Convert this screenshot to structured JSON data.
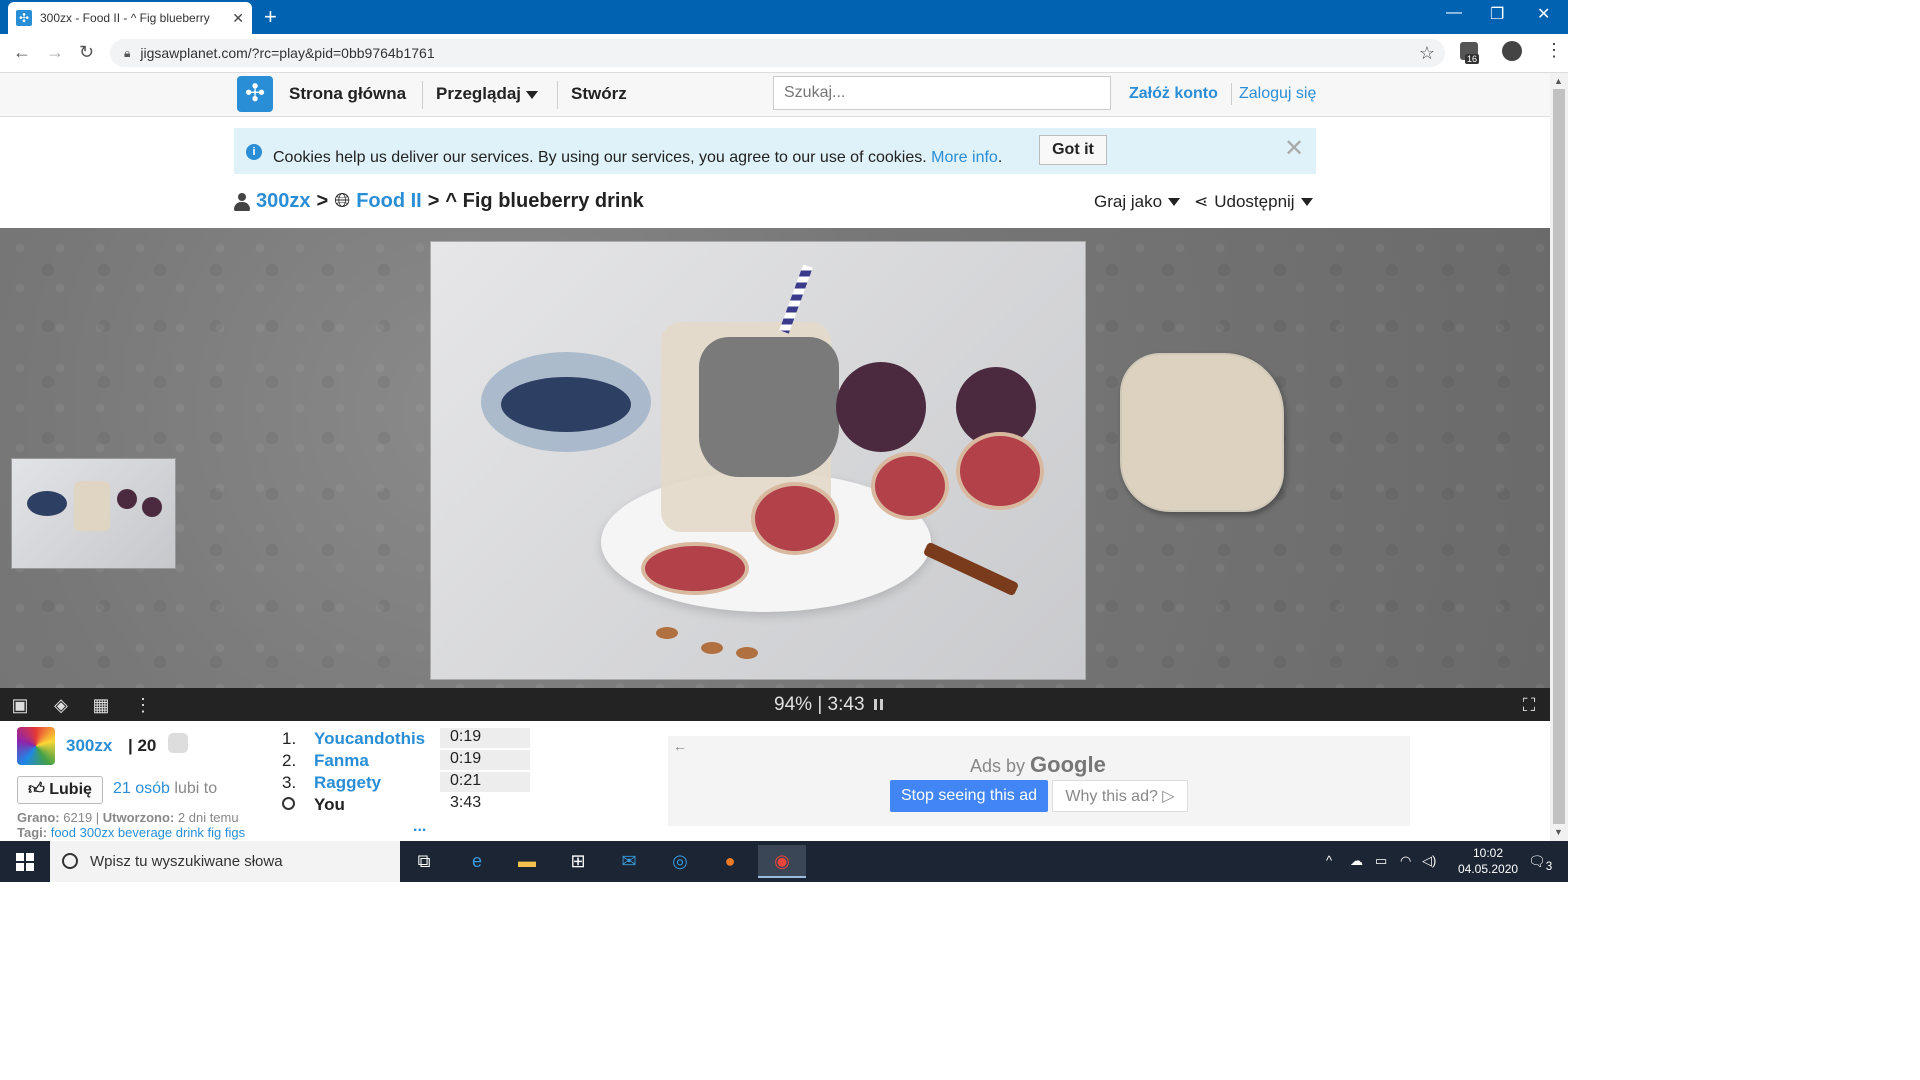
{
  "browser": {
    "tab_title": "300zx - Food II - ^ Fig blueberry",
    "url": "jigsawplanet.com/?rc=play&pid=0bb9764b1761",
    "extension_badge": "16"
  },
  "header": {
    "nav": [
      "Strona główna",
      "Przeglądaj",
      "Stwórz"
    ],
    "search_placeholder": "Szukaj...",
    "signup": "Załóż konto",
    "login": "Zaloguj się"
  },
  "cookie": {
    "message": "Cookies help us deliver our services. By using our services, you agree to our use of cookies.",
    "more_info": "More info",
    "period": ".",
    "got_it": "Got it",
    "close": "✕"
  },
  "breadcrumb": {
    "user": "300zx",
    "album": "Food II",
    "puzzle": "^ Fig blueberry drink",
    "sep": ">"
  },
  "actions": {
    "play_as": "Graj jako",
    "share": "Udostępnij"
  },
  "game": {
    "progress": "94%",
    "separator": "|",
    "time": "3:43"
  },
  "info": {
    "author": "300zx",
    "pieces": "| 20",
    "like_button": "Lubię",
    "likes_link": "21 osób",
    "likes_text": "lubi to",
    "played_label": "Grano:",
    "played_value": "6219",
    "created_label": "Utworzono:",
    "created_value": "2 dni temu",
    "tags_label": "Tagi:",
    "tags": "food 300zx beverage drink fig figs",
    "more": "..."
  },
  "scores": [
    {
      "rank": "1.",
      "name": "Youcandothis",
      "time": "0:19"
    },
    {
      "rank": "2.",
      "name": "Fanma",
      "time": "0:19"
    },
    {
      "rank": "3.",
      "name": "Raggety",
      "time": "0:21"
    },
    {
      "rank": "",
      "name": "You",
      "time": "3:43"
    }
  ],
  "ad": {
    "ads_by": "Ads by",
    "google": "Google",
    "stop": "Stop seeing this ad",
    "why": "Why this ad? ▷"
  },
  "taskbar": {
    "search_placeholder": "Wpisz tu wyszukiwane słowa",
    "time": "10:02",
    "date": "04.05.2020",
    "notifications": "3"
  }
}
